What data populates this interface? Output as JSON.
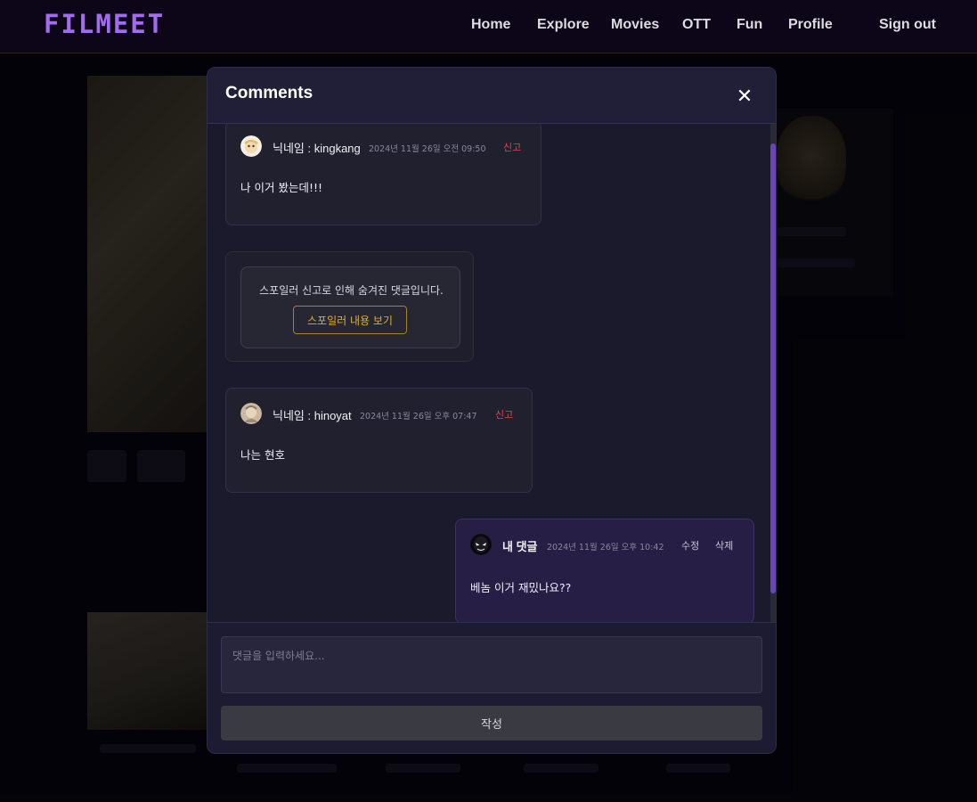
{
  "nav": {
    "logo": "FILMEET",
    "links": [
      "Home",
      "Explore",
      "Movies",
      "OTT",
      "Fun",
      "Profile"
    ],
    "signout": "Sign out"
  },
  "modal": {
    "title": "Comments",
    "close_icon": "close-icon",
    "comments": [
      {
        "nickname": "닉네임 : kingkang",
        "date": "2024년 11월 26일 오전 09:50",
        "report": "신고",
        "text": "나 이거 봤는데!!!"
      },
      {
        "nickname": "닉네임 : hinoyat",
        "date": "2024년 11월 26일 오후 07:47",
        "report": "신고",
        "text": "나는 현호"
      }
    ],
    "spoiler": {
      "message": "스포일러 신고로 인해 숨겨진 댓글입니다.",
      "button": "스포일러 내용 보기"
    },
    "my_comment": {
      "label": "내 댓글",
      "date": "2024년 11월 26일 오후 10:42",
      "edit": "수정",
      "delete": "삭제",
      "text": "베놈 이거 재밌나요??"
    },
    "input": {
      "placeholder": "댓글을 입력하세요...",
      "value": ""
    },
    "submit": "작성"
  },
  "colors": {
    "accent": "#a36bf0",
    "report": "#e0444c",
    "spoiler_button": "#d9ad3c"
  }
}
